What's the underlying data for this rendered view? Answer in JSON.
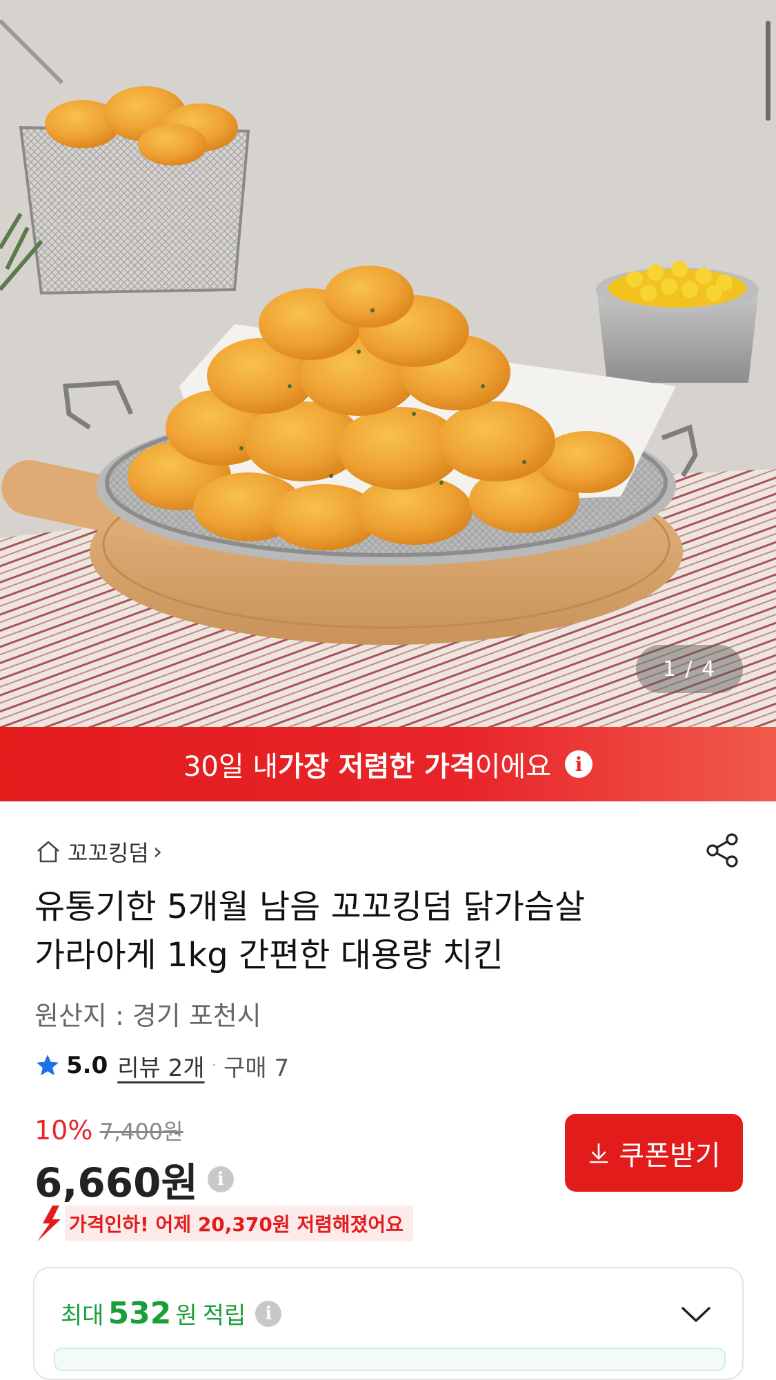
{
  "hero": {
    "pager": "1 / 4"
  },
  "banner": {
    "prefix": "30일 내 ",
    "highlight": "가장 저렴한 가격",
    "suffix": "이에요",
    "info_glyph": "i"
  },
  "store": {
    "name": "꼬꼬킹덤",
    "chevron": "›"
  },
  "product": {
    "title_line1": "유통기한 5개월 남음 꼬꼬킹덤 닭가슴살",
    "title_line2": "가라아게 1kg 간편한 대용량 치킨",
    "origin": "원산지 : 경기 포천시"
  },
  "rating": {
    "score": "5.0",
    "reviews": "리뷰 2개",
    "separator": "·",
    "purchases": "구매 7"
  },
  "price": {
    "discount": "10%",
    "original": "7,400원",
    "current": "6,660원",
    "info_glyph": "i"
  },
  "coupon": {
    "label": "쿠폰받기"
  },
  "price_drop": {
    "message": "가격인하! 어제 20,370원 저렴해졌어요"
  },
  "points": {
    "prefix": "최대",
    "amount": "532",
    "unit": "원",
    "suffix": "적립",
    "info_glyph": "i"
  },
  "colors": {
    "accent_red": "#e21b1b",
    "points_green": "#1a9e3a"
  }
}
